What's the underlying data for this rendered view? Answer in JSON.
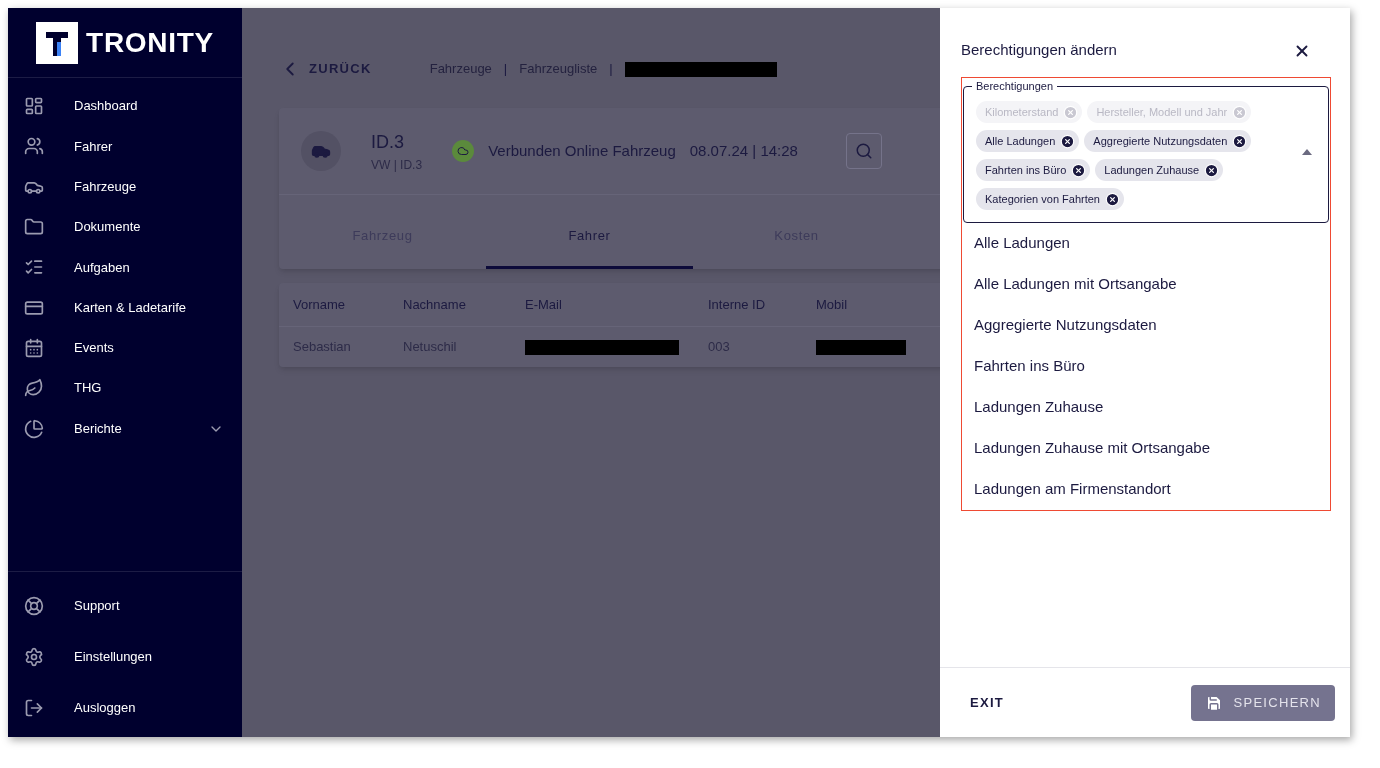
{
  "sidebar": {
    "logo": "TRONITY",
    "items": [
      {
        "label": "Dashboard",
        "kind": "link"
      },
      {
        "label": "Fahrer",
        "kind": "link"
      },
      {
        "label": "Fahrzeuge",
        "kind": "link"
      },
      {
        "label": "Dokumente",
        "kind": "link"
      },
      {
        "label": "Aufgaben",
        "kind": "link"
      },
      {
        "label": "Karten & Ladetarife",
        "kind": "link"
      },
      {
        "label": "Events",
        "kind": "link"
      },
      {
        "label": "THG",
        "kind": "link"
      },
      {
        "label": "Berichte",
        "kind": "group",
        "expanded": false
      }
    ],
    "bottom_items": [
      {
        "label": "Support"
      },
      {
        "label": "Einstellungen"
      },
      {
        "label": "Ausloggen"
      }
    ]
  },
  "main": {
    "back": "ZURÜCK",
    "breadcrumb": {
      "items": [
        "Fahrzeuge",
        "Fahrzeugliste"
      ],
      "separator": "|"
    },
    "vehicle": {
      "name": "ID.3",
      "subtitle": "VW | ID.3",
      "status": "Verbunden Online Fahrzeug",
      "timestamp": "08.07.24 | 14:28"
    },
    "tabs": [
      {
        "label": "Fahrzeug",
        "selected": false
      },
      {
        "label": "Fahrer",
        "selected": true
      },
      {
        "label": "Kosten",
        "selected": false
      }
    ],
    "table": {
      "columns": [
        "Vorname",
        "Nachname",
        "E-Mail",
        "Interne ID",
        "Mobil"
      ],
      "rows": [
        {
          "cells": [
            {
              "kind": "text",
              "text": "Sebastian"
            },
            {
              "kind": "text",
              "text": "Netuschil"
            },
            {
              "kind": "redacted"
            },
            {
              "kind": "text",
              "text": "003"
            },
            {
              "kind": "redacted"
            }
          ]
        }
      ]
    }
  },
  "drawer": {
    "title": "Berechtigungen ändern",
    "field": {
      "label": "Berechtigungen",
      "expanded": true,
      "highlighted": true,
      "chips": [
        {
          "label": "Kilometerstand",
          "disabled": true
        },
        {
          "label": "Hersteller, Modell und Jahr",
          "disabled": true
        },
        {
          "label": "Alle Ladungen",
          "disabled": false
        },
        {
          "label": "Aggregierte Nutzungsdaten",
          "disabled": false
        },
        {
          "label": "Fahrten ins Büro",
          "disabled": false
        },
        {
          "label": "Ladungen Zuhause",
          "disabled": false
        },
        {
          "label": "Kategorien von Fahrten",
          "disabled": false
        }
      ]
    },
    "options": [
      "Alle Ladungen",
      "Alle Ladungen mit Ortsangabe",
      "Aggregierte Nutzungsdaten",
      "Fahrten ins Büro",
      "Ladungen Zuhause",
      "Ladungen Zuhause mit Ortsangabe",
      "Ladungen am Firmenstandort"
    ],
    "exit": "EXIT",
    "save": {
      "label": "SPEICHERN",
      "disabled": true
    }
  }
}
